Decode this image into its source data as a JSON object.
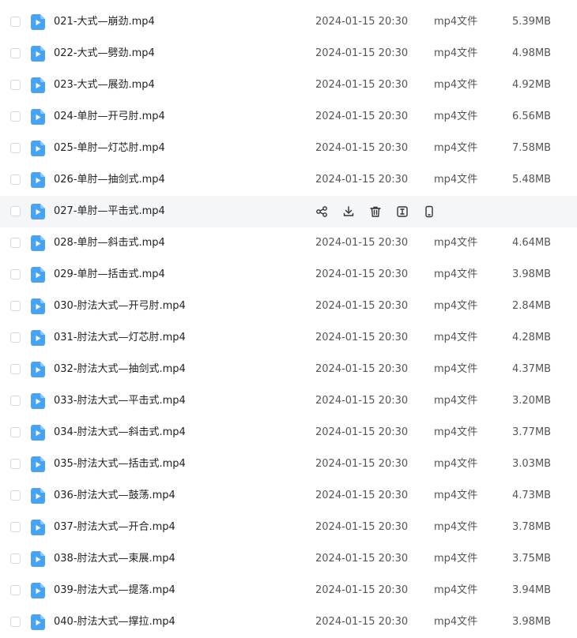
{
  "colors": {
    "icon_blue": "#4aa3f0",
    "hover_bg": "#f5f6f8",
    "action_icon": "#333333"
  },
  "files": [
    {
      "name": "021-大式—崩劲.mp4",
      "date": "2024-01-15 20:30",
      "type": "mp4文件",
      "size": "5.39MB"
    },
    {
      "name": "022-大式—劈劲.mp4",
      "date": "2024-01-15 20:30",
      "type": "mp4文件",
      "size": "4.98MB"
    },
    {
      "name": "023-大式—展劲.mp4",
      "date": "2024-01-15 20:30",
      "type": "mp4文件",
      "size": "4.92MB"
    },
    {
      "name": "024-单肘—开弓肘.mp4",
      "date": "2024-01-15 20:30",
      "type": "mp4文件",
      "size": "6.56MB"
    },
    {
      "name": "025-单肘—灯芯肘.mp4",
      "date": "2024-01-15 20:30",
      "type": "mp4文件",
      "size": "7.58MB"
    },
    {
      "name": "026-单肘—抽剑式.mp4",
      "date": "2024-01-15 20:30",
      "type": "mp4文件",
      "size": "5.48MB"
    },
    {
      "name": "027-单肘—平击式.mp4",
      "date": "",
      "type": "",
      "size": "",
      "hovered": true
    },
    {
      "name": "028-单肘—斜击式.mp4",
      "date": "2024-01-15 20:30",
      "type": "mp4文件",
      "size": "4.64MB"
    },
    {
      "name": "029-单肘—括击式.mp4",
      "date": "2024-01-15 20:30",
      "type": "mp4文件",
      "size": "3.98MB"
    },
    {
      "name": "030-肘法大式—开弓肘.mp4",
      "date": "2024-01-15 20:30",
      "type": "mp4文件",
      "size": "2.84MB"
    },
    {
      "name": "031-肘法大式—灯芯肘.mp4",
      "date": "2024-01-15 20:30",
      "type": "mp4文件",
      "size": "4.28MB"
    },
    {
      "name": "032-肘法大式—抽剑式.mp4",
      "date": "2024-01-15 20:30",
      "type": "mp4文件",
      "size": "4.37MB"
    },
    {
      "name": "033-肘法大式—平击式.mp4",
      "date": "2024-01-15 20:30",
      "type": "mp4文件",
      "size": "3.20MB"
    },
    {
      "name": "034-肘法大式—斜击式.mp4",
      "date": "2024-01-15 20:30",
      "type": "mp4文件",
      "size": "3.77MB"
    },
    {
      "name": "035-肘法大式—括击式.mp4",
      "date": "2024-01-15 20:30",
      "type": "mp4文件",
      "size": "3.03MB"
    },
    {
      "name": "036-肘法大式—鼓荡.mp4",
      "date": "2024-01-15 20:30",
      "type": "mp4文件",
      "size": "4.73MB"
    },
    {
      "name": "037-肘法大式—开合.mp4",
      "date": "2024-01-15 20:30",
      "type": "mp4文件",
      "size": "3.78MB"
    },
    {
      "name": "038-肘法大式—束展.mp4",
      "date": "2024-01-15 20:30",
      "type": "mp4文件",
      "size": "3.75MB"
    },
    {
      "name": "039-肘法大式—提落.mp4",
      "date": "2024-01-15 20:30",
      "type": "mp4文件",
      "size": "3.94MB"
    },
    {
      "name": "040-肘法大式—撑拉.mp4",
      "date": "2024-01-15 20:30",
      "type": "mp4文件",
      "size": "3.98MB"
    }
  ],
  "hover_actions": [
    {
      "icon": "share-icon"
    },
    {
      "icon": "download-icon"
    },
    {
      "icon": "delete-icon"
    },
    {
      "icon": "rename-icon"
    },
    {
      "icon": "mobile-icon"
    }
  ]
}
